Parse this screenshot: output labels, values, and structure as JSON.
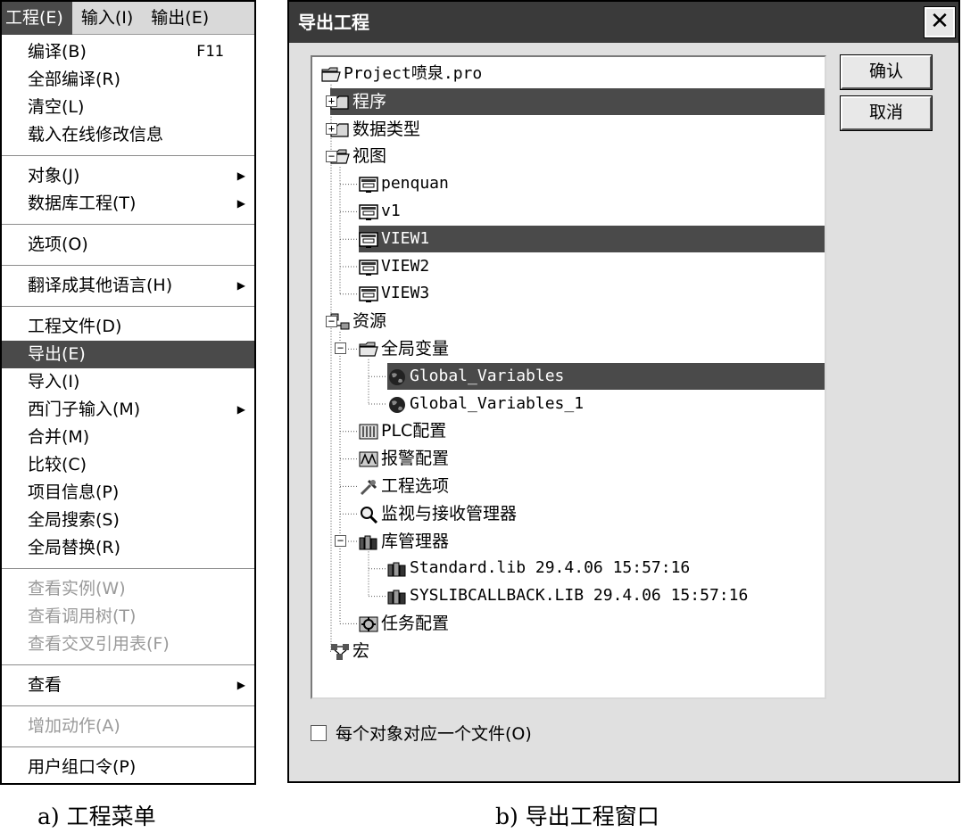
{
  "menu": {
    "bar": [
      "工程(E)",
      "输入(I)",
      "输出(E)"
    ],
    "items": [
      {
        "label": "编译(B)",
        "shortcut": "F11"
      },
      {
        "label": "全部编译(R)"
      },
      {
        "label": "清空(L)"
      },
      {
        "label": "载入在线修改信息"
      },
      {
        "sep": true
      },
      {
        "label": "对象(J)",
        "submenu": true
      },
      {
        "label": "数据库工程(T)",
        "submenu": true
      },
      {
        "sep": true
      },
      {
        "label": "选项(O)"
      },
      {
        "sep": true
      },
      {
        "label": "翻译成其他语言(H)",
        "submenu": true
      },
      {
        "sep": true
      },
      {
        "label": "工程文件(D)"
      },
      {
        "label": "导出(E)",
        "highlight": true
      },
      {
        "label": "导入(I)"
      },
      {
        "label": "西门子输入(M)",
        "submenu": true
      },
      {
        "label": "合并(M)"
      },
      {
        "label": "比较(C)"
      },
      {
        "label": "项目信息(P)"
      },
      {
        "label": "全局搜索(S)"
      },
      {
        "label": "全局替换(R)"
      },
      {
        "sep": true
      },
      {
        "label": "查看实例(W)",
        "disabled": true
      },
      {
        "label": "查看调用树(T)",
        "disabled": true
      },
      {
        "label": "查看交叉引用表(F)",
        "disabled": true
      },
      {
        "sep": true
      },
      {
        "label": "查看",
        "submenu": true
      },
      {
        "sep": true
      },
      {
        "label": "增加动作(A)",
        "disabled": true
      },
      {
        "sep": true
      },
      {
        "label": "用户组口令(P)"
      }
    ]
  },
  "dialog": {
    "title": "导出工程",
    "ok_label": "确认",
    "cancel_label": "取消",
    "checkbox_label": "每个对象对应一个文件(O)",
    "tree": [
      {
        "label": "Project喷泉.pro",
        "level": 0,
        "icon": "folder-open-icon",
        "mono": true
      },
      {
        "label": "程序",
        "level": 1,
        "icon": "folder-icon",
        "expander": "+",
        "selected": true
      },
      {
        "label": "数据类型",
        "level": 1,
        "icon": "folder-icon",
        "expander": "+"
      },
      {
        "label": "视图",
        "level": 1,
        "icon": "folder-open-icon",
        "expander": "-"
      },
      {
        "label": "penquan",
        "level": 2,
        "icon": "visualization-icon",
        "mono": true
      },
      {
        "label": "v1",
        "level": 2,
        "icon": "visualization-icon",
        "mono": true
      },
      {
        "label": "VIEW1",
        "level": 2,
        "icon": "visualization-icon",
        "mono": true,
        "selected": true
      },
      {
        "label": "VIEW2",
        "level": 2,
        "icon": "visualization-icon",
        "mono": true
      },
      {
        "label": "VIEW3",
        "level": 2,
        "icon": "visualization-icon",
        "mono": true
      },
      {
        "label": "资源",
        "level": 1,
        "icon": "resources-icon",
        "expander": "-"
      },
      {
        "label": "全局变量",
        "level": 2,
        "icon": "folder-open-icon",
        "expander": "-"
      },
      {
        "label": "Global_Variables",
        "level": 3,
        "icon": "globe-icon",
        "mono": true,
        "selected": true
      },
      {
        "label": "Global_Variables_1",
        "level": 3,
        "icon": "globe-icon",
        "mono": true
      },
      {
        "label": "PLC配置",
        "level": 2,
        "icon": "plc-config-icon"
      },
      {
        "label": "报警配置",
        "level": 2,
        "icon": "alarm-config-icon"
      },
      {
        "label": "工程选项",
        "level": 2,
        "icon": "tools-icon"
      },
      {
        "label": "监视与接收管理器",
        "level": 2,
        "icon": "magnifier-icon"
      },
      {
        "label": "库管理器",
        "level": 2,
        "icon": "library-icon",
        "expander": "-"
      },
      {
        "label": "Standard.lib 29.4.06 15:57:16",
        "level": 3,
        "icon": "library-icon",
        "mono": true
      },
      {
        "label": "SYSLIBCALLBACK.LIB 29.4.06 15:57:16",
        "level": 3,
        "icon": "library-icon",
        "mono": true
      },
      {
        "label": "任务配置",
        "level": 2,
        "icon": "task-config-icon"
      },
      {
        "label": "宏",
        "level": 1,
        "icon": "macro-icon"
      }
    ]
  },
  "captions": {
    "left": "a) 工程菜单",
    "right": "b) 导出工程窗口"
  }
}
